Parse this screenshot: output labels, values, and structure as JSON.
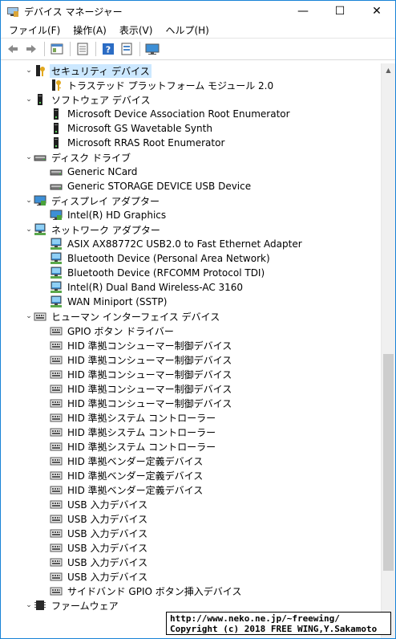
{
  "window": {
    "title": "デバイス マネージャー",
    "minimize": "—",
    "maximize": "☐",
    "close": "✕"
  },
  "menu": [
    "ファイル(F)",
    "操作(A)",
    "表示(V)",
    "ヘルプ(H)"
  ],
  "tree": [
    {
      "level": 0,
      "expander": "open",
      "icon": "security-icon",
      "label": "セキュリティ デバイス",
      "selected": true
    },
    {
      "level": 1,
      "icon": "key-icon",
      "label": "トラステッド プラットフォーム モジュール 2.0"
    },
    {
      "level": 0,
      "expander": "open",
      "icon": "software-device-icon",
      "label": "ソフトウェア デバイス"
    },
    {
      "level": 1,
      "icon": "software-device-icon",
      "label": "Microsoft Device Association Root Enumerator"
    },
    {
      "level": 1,
      "icon": "software-device-icon",
      "label": "Microsoft GS Wavetable Synth"
    },
    {
      "level": 1,
      "icon": "software-device-icon",
      "label": "Microsoft RRAS Root Enumerator"
    },
    {
      "level": 0,
      "expander": "open",
      "icon": "disk-icon",
      "label": "ディスク ドライブ"
    },
    {
      "level": 1,
      "icon": "disk-icon",
      "label": "Generic NCard"
    },
    {
      "level": 1,
      "icon": "disk-icon",
      "label": "Generic STORAGE DEVICE USB Device"
    },
    {
      "level": 0,
      "expander": "open",
      "icon": "display-icon",
      "label": "ディスプレイ アダプター"
    },
    {
      "level": 1,
      "icon": "display-icon",
      "label": "Intel(R) HD Graphics"
    },
    {
      "level": 0,
      "expander": "open",
      "icon": "network-icon",
      "label": "ネットワーク アダプター"
    },
    {
      "level": 1,
      "icon": "network-icon",
      "label": "ASIX AX88772C USB2.0 to Fast Ethernet Adapter"
    },
    {
      "level": 1,
      "icon": "network-icon",
      "label": "Bluetooth Device (Personal Area Network)"
    },
    {
      "level": 1,
      "icon": "network-icon",
      "label": "Bluetooth Device (RFCOMM Protocol TDI)"
    },
    {
      "level": 1,
      "icon": "network-icon",
      "label": "Intel(R) Dual Band Wireless-AC 3160"
    },
    {
      "level": 1,
      "icon": "network-icon",
      "label": "WAN Miniport (SSTP)"
    },
    {
      "level": 0,
      "expander": "open",
      "icon": "hid-icon",
      "label": "ヒューマン インターフェイス デバイス"
    },
    {
      "level": 1,
      "icon": "hid-icon",
      "label": "GPIO ボタン ドライバー"
    },
    {
      "level": 1,
      "icon": "hid-icon",
      "label": "HID 準拠コンシューマー制御デバイス"
    },
    {
      "level": 1,
      "icon": "hid-icon",
      "label": "HID 準拠コンシューマー制御デバイス"
    },
    {
      "level": 1,
      "icon": "hid-icon",
      "label": "HID 準拠コンシューマー制御デバイス"
    },
    {
      "level": 1,
      "icon": "hid-icon",
      "label": "HID 準拠コンシューマー制御デバイス"
    },
    {
      "level": 1,
      "icon": "hid-icon",
      "label": "HID 準拠コンシューマー制御デバイス"
    },
    {
      "level": 1,
      "icon": "hid-icon",
      "label": "HID 準拠システム コントローラー"
    },
    {
      "level": 1,
      "icon": "hid-icon",
      "label": "HID 準拠システム コントローラー"
    },
    {
      "level": 1,
      "icon": "hid-icon",
      "label": "HID 準拠システム コントローラー"
    },
    {
      "level": 1,
      "icon": "hid-icon",
      "label": "HID 準拠ベンダー定義デバイス"
    },
    {
      "level": 1,
      "icon": "hid-icon",
      "label": "HID 準拠ベンダー定義デバイス"
    },
    {
      "level": 1,
      "icon": "hid-icon",
      "label": "HID 準拠ベンダー定義デバイス"
    },
    {
      "level": 1,
      "icon": "hid-icon",
      "label": "USB 入力デバイス"
    },
    {
      "level": 1,
      "icon": "hid-icon",
      "label": "USB 入力デバイス"
    },
    {
      "level": 1,
      "icon": "hid-icon",
      "label": "USB 入力デバイス"
    },
    {
      "level": 1,
      "icon": "hid-icon",
      "label": "USB 入力デバイス"
    },
    {
      "level": 1,
      "icon": "hid-icon",
      "label": "USB 入力デバイス"
    },
    {
      "level": 1,
      "icon": "hid-icon",
      "label": "USB 入力デバイス"
    },
    {
      "level": 1,
      "icon": "hid-icon",
      "label": "サイドバンド GPIO ボタン挿入デバイス"
    },
    {
      "level": 0,
      "expander": "open",
      "icon": "firmware-icon",
      "label": "ファームウェア"
    }
  ],
  "watermark": {
    "line1": "http://www.neko.ne.jp/~freewing/",
    "line2": "Copyright (c) 2018 FREE WING,Y.Sakamoto"
  },
  "colors": {
    "accent": "#1883d7",
    "selected": "#cce8ff"
  }
}
